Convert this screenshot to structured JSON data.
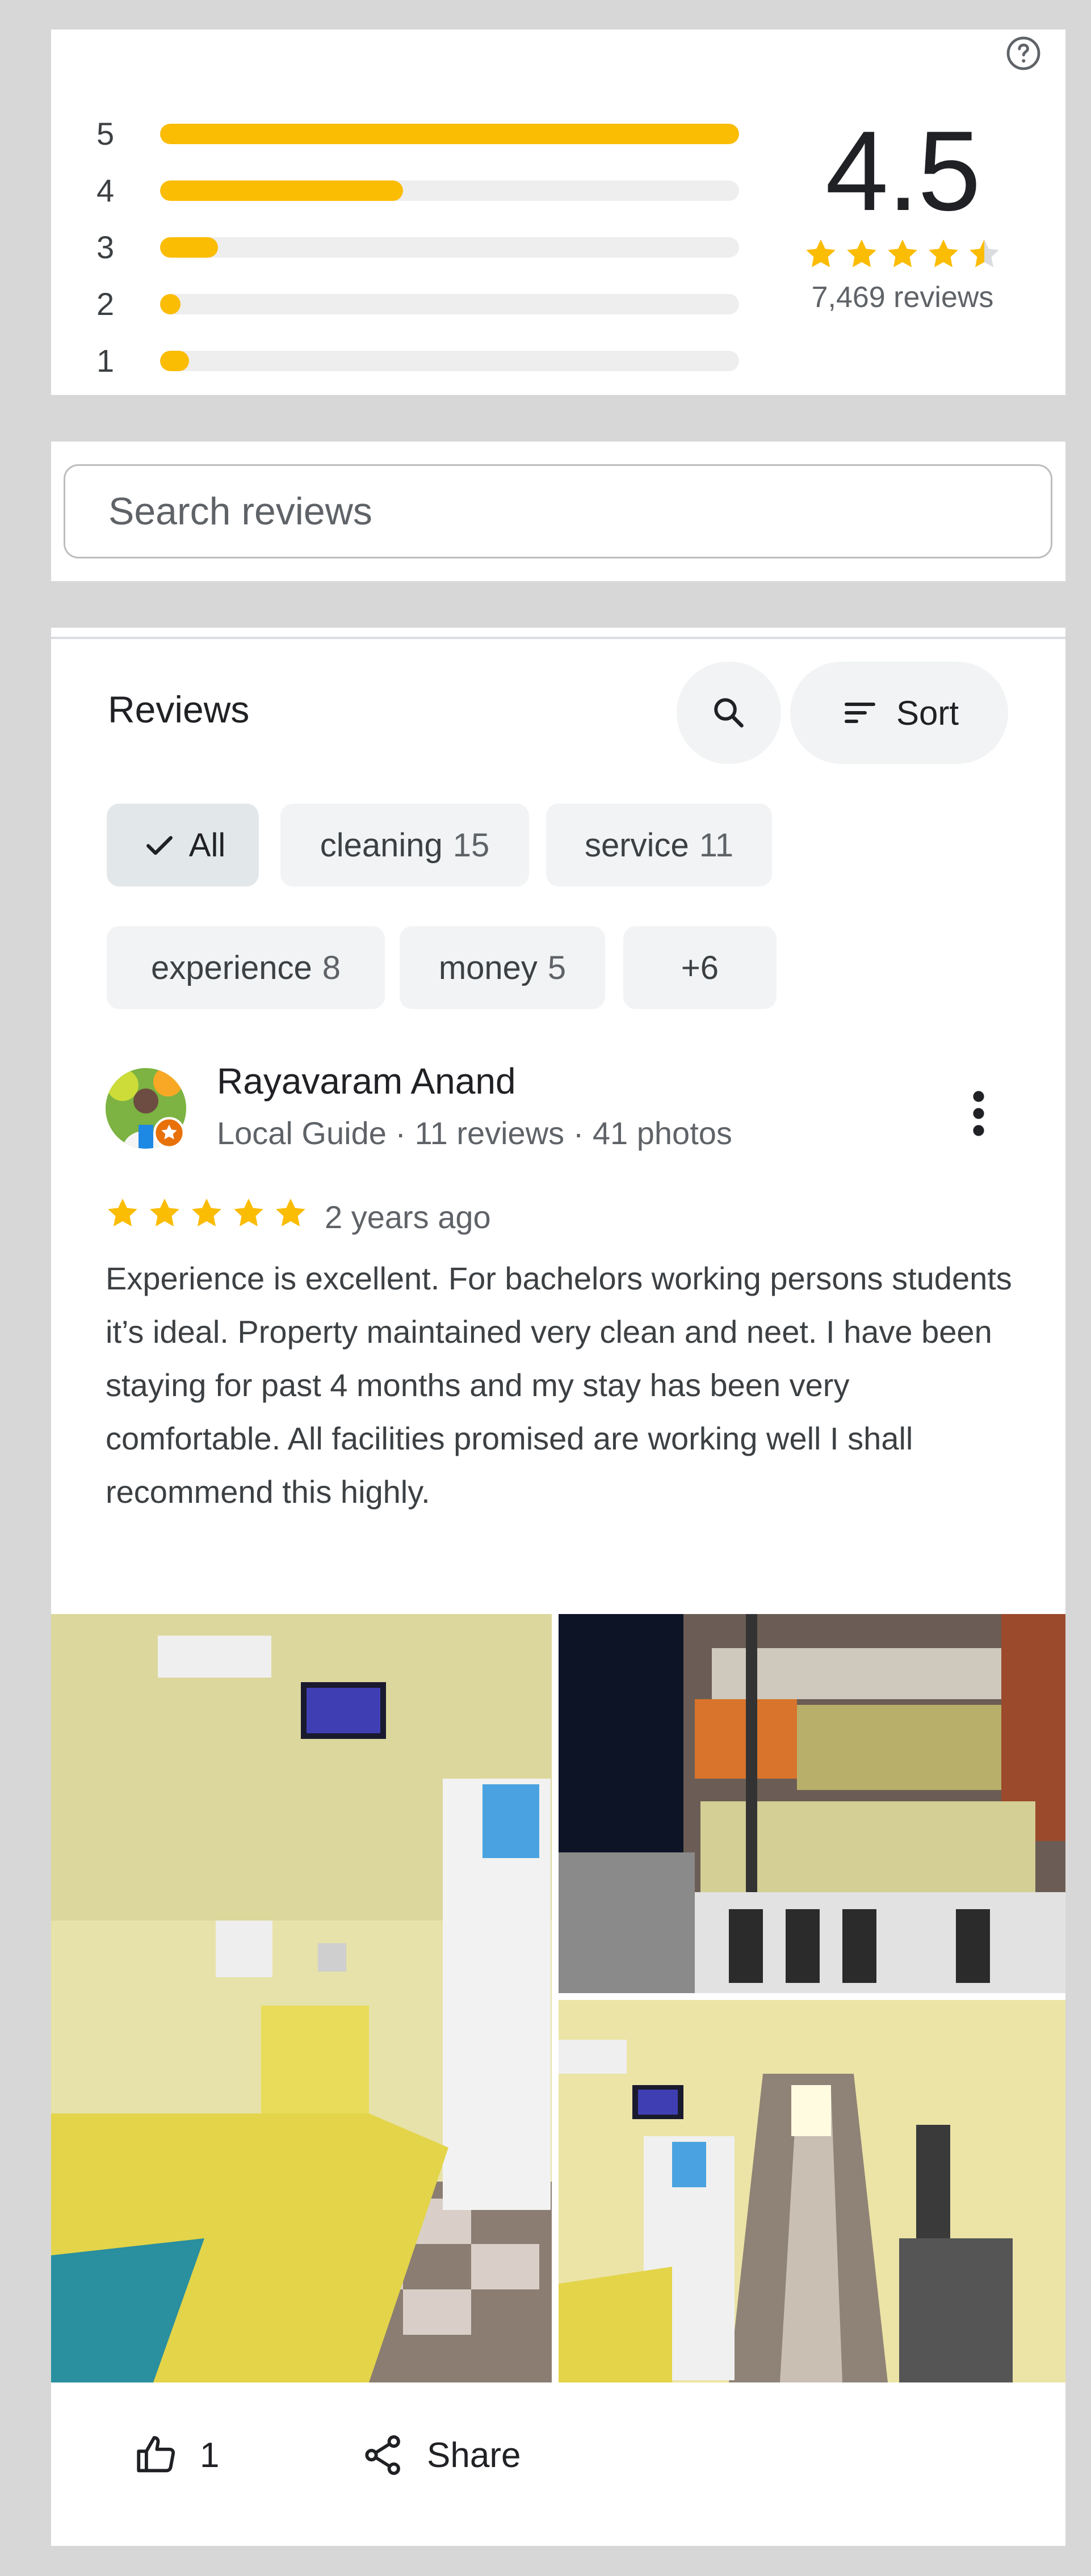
{
  "summary": {
    "average": "4.5",
    "stars_value": 4.5,
    "review_count": "7,469 reviews",
    "histogram": [
      {
        "label": "5",
        "fraction": 1.0
      },
      {
        "label": "4",
        "fraction": 0.42
      },
      {
        "label": "3",
        "fraction": 0.1
      },
      {
        "label": "2",
        "fraction": 0.03
      },
      {
        "label": "1",
        "fraction": 0.05
      }
    ],
    "help_icon": "help-circle-icon",
    "bar_color": "#fbbc04"
  },
  "search": {
    "placeholder": "Search reviews",
    "value": ""
  },
  "reviews_section": {
    "title": "Reviews",
    "search_icon": "search-icon",
    "sort_label": "Sort",
    "sort_icon": "sort-icon",
    "chips": [
      {
        "label": "All",
        "count": "",
        "selected": true
      },
      {
        "label": "cleaning",
        "count": "15",
        "selected": false
      },
      {
        "label": "service",
        "count": "11",
        "selected": false
      },
      {
        "label": "experience",
        "count": "8",
        "selected": false
      },
      {
        "label": "money",
        "count": "5",
        "selected": false
      },
      {
        "label": "+6",
        "count": "",
        "selected": false
      }
    ]
  },
  "review": {
    "author": "Rayavaram Anand",
    "meta": "Local Guide · 11 reviews · 41 photos",
    "rating": 5,
    "date": "2 years ago",
    "text": "Experience is excellent. For bachelors working persons students it’s ideal. Property maintained very clean and neet. I have been staying for past 4 months and my stay has been very comfortable. All facilities promised are working well I shall recommend this highly.",
    "likes": "1",
    "share_label": "Share"
  },
  "colors": {
    "accent_star": "#fbbc04",
    "chip_bg": "#f1f3f4",
    "chip_selected_bg": "#e2e8ea",
    "page_bg": "#d7d7d7"
  }
}
